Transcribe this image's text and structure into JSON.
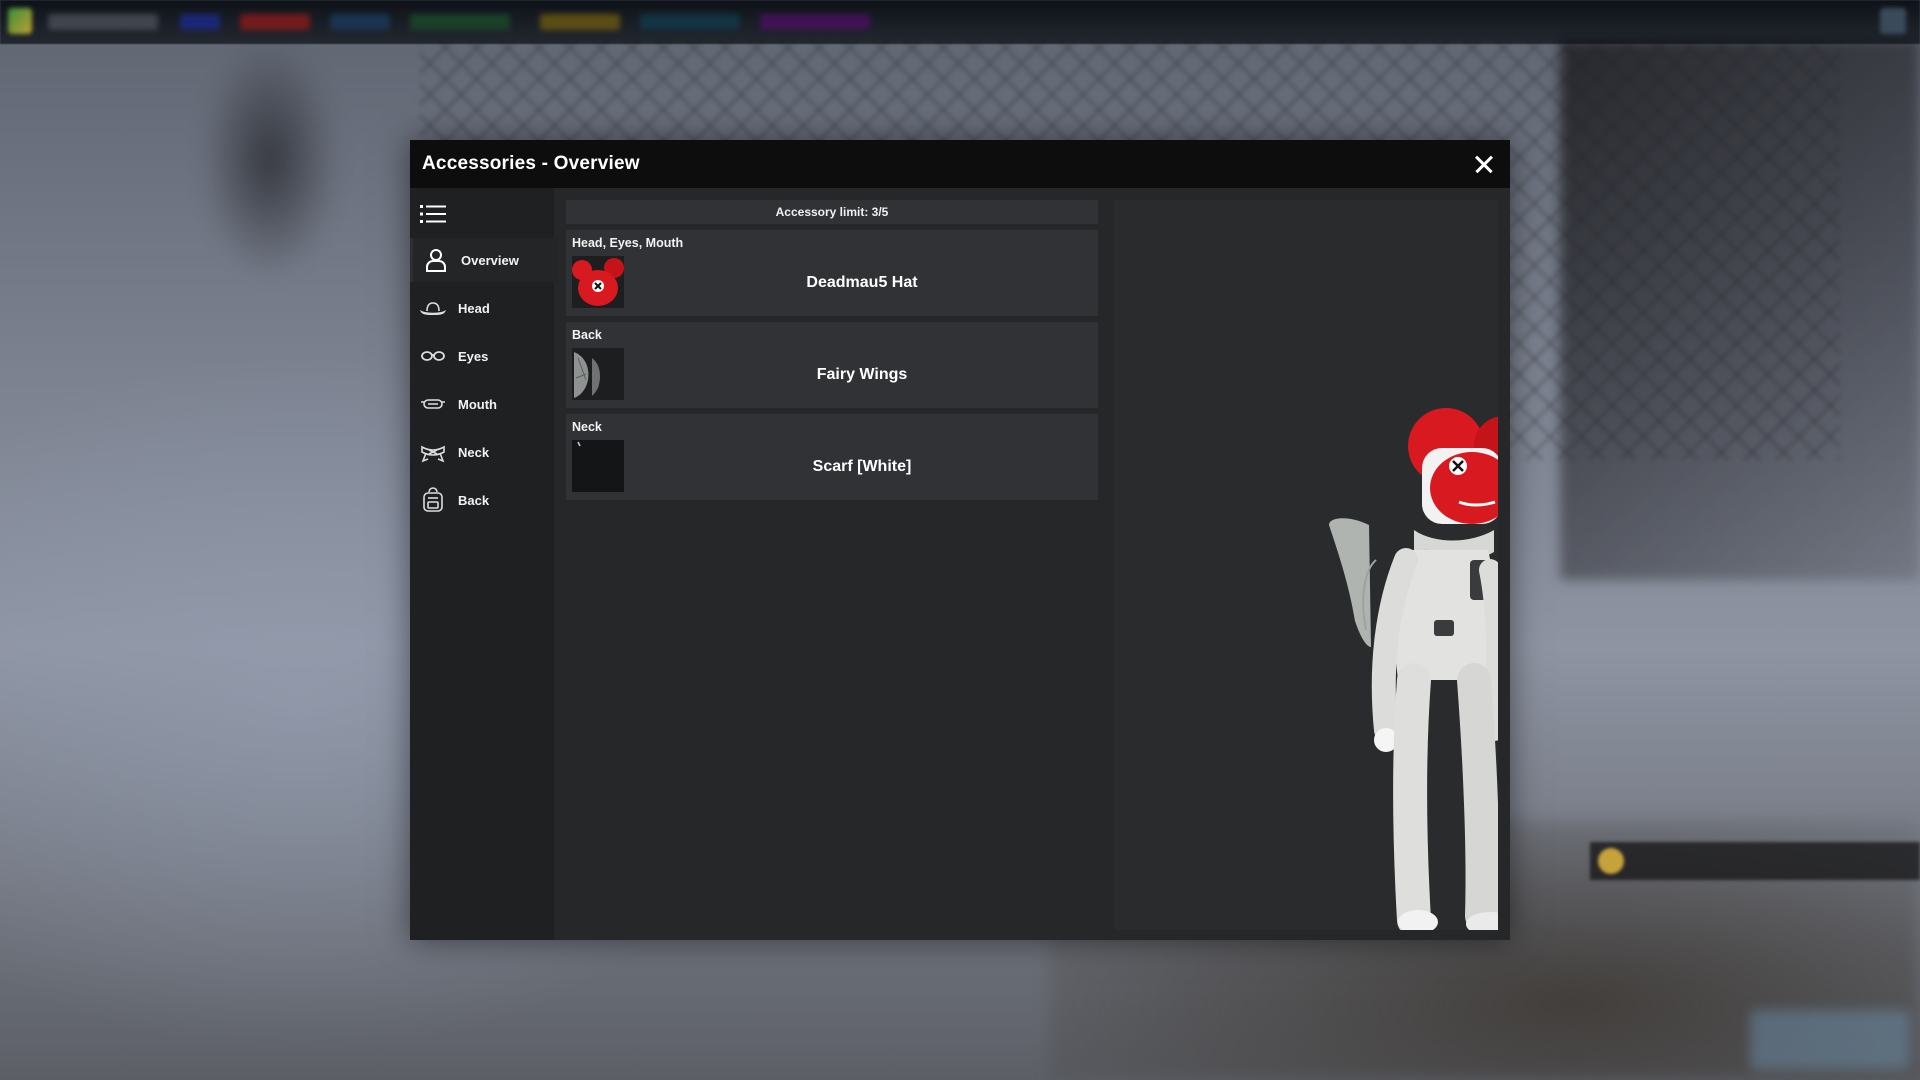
{
  "window": {
    "title": "Accessories - Overview"
  },
  "sidebar": {
    "items": [
      {
        "label": "Overview",
        "icon": "person-icon"
      },
      {
        "label": "Head",
        "icon": "hat-icon"
      },
      {
        "label": "Eyes",
        "icon": "glasses-icon"
      },
      {
        "label": "Mouth",
        "icon": "mask-icon"
      },
      {
        "label": "Neck",
        "icon": "scarf-icon"
      },
      {
        "label": "Back",
        "icon": "backpack-icon"
      }
    ],
    "active": "Overview"
  },
  "content": {
    "limit_text": "Accessory limit: 3/5",
    "accessories": [
      {
        "slot": "Head, Eyes, Mouth",
        "name": "Deadmau5 Hat",
        "thumb": "deadmau5-hat-thumbnail"
      },
      {
        "slot": "Back",
        "name": "Fairy Wings",
        "thumb": "fairy-wings-thumbnail"
      },
      {
        "slot": "Neck",
        "name": "Scarf [White]",
        "thumb": "scarf-white-thumbnail"
      }
    ]
  },
  "colors": {
    "window_bg": "#262729",
    "titlebar_bg": "#0d0d0e",
    "sidebar_bg": "#1f2022",
    "card_bg": "#313235",
    "accent_red": "#d8191f"
  }
}
